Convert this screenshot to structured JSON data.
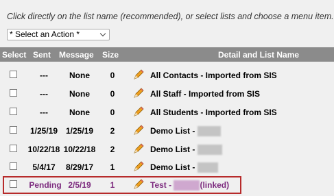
{
  "instructions": "Click directly on the list name (recommended), or select lists and choose a menu item.",
  "action_select": {
    "value": "* Select an Action *"
  },
  "columns": {
    "select": "Select",
    "sent": "Sent",
    "message": "Message",
    "size": "Size",
    "detail": "Detail and List Name"
  },
  "rows": [
    {
      "sent": "---",
      "message": "None",
      "size": "0",
      "name": "All Contacts - Imported from SIS"
    },
    {
      "sent": "---",
      "message": "None",
      "size": "0",
      "name": "All Staff - Imported from SIS"
    },
    {
      "sent": "---",
      "message": "None",
      "size": "0",
      "name": "All Students - Imported from SIS"
    },
    {
      "sent": "1/25/19",
      "message": "1/25/19",
      "size": "2",
      "name": "Demo List -"
    },
    {
      "sent": "10/22/18",
      "message": "10/22/18",
      "size": "2",
      "name": "Demo List -"
    },
    {
      "sent": "5/4/17",
      "message": "8/29/17",
      "size": "1",
      "name": "Demo List -"
    },
    {
      "sent": "Pending",
      "message": "2/5/19",
      "size": "1",
      "name": "Test -",
      "suffix": "(linked)"
    }
  ],
  "colors": {
    "header_bg": "#8b8b8b",
    "pending_text": "#7c2a7e",
    "highlight_border": "#b72b2b"
  }
}
